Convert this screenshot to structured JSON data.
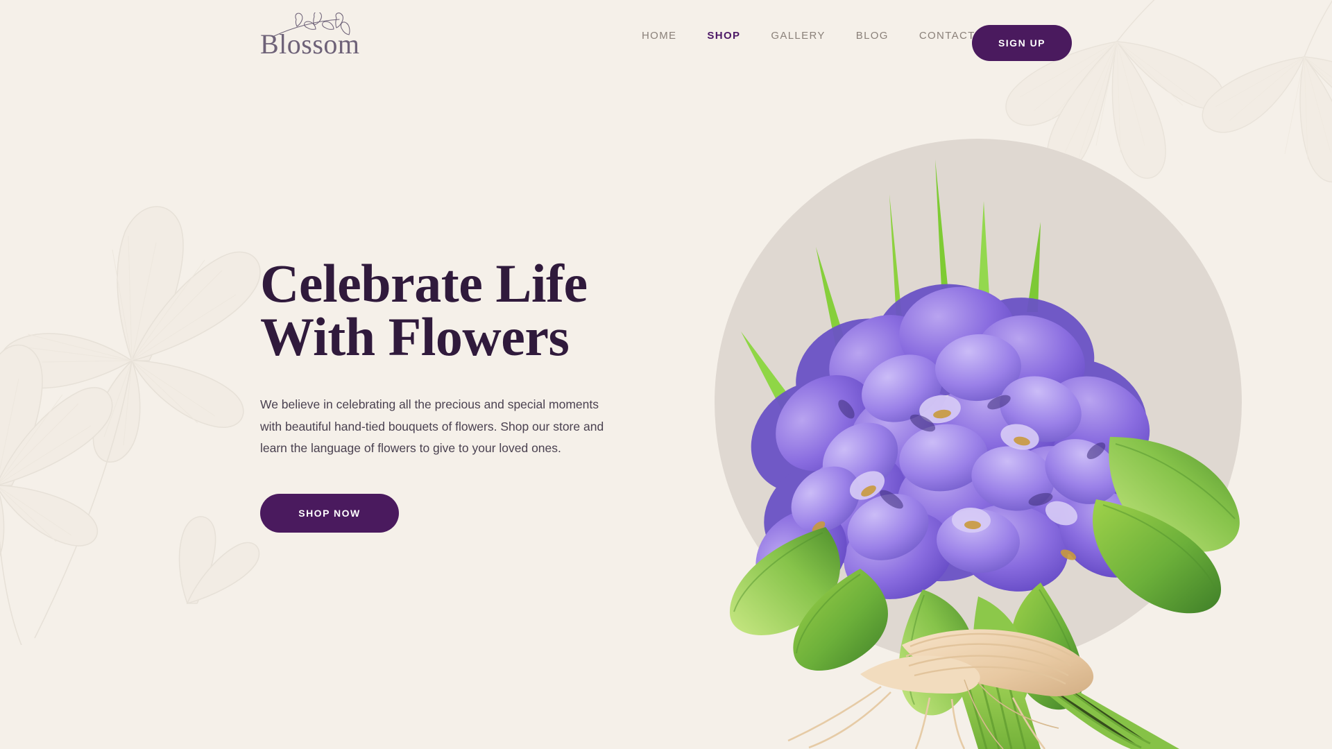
{
  "brand": {
    "name": "Blossom",
    "sprig_icon": "leaf-sprig-icon"
  },
  "nav": {
    "items": [
      {
        "label": "HOME",
        "active": false
      },
      {
        "label": "SHOP",
        "active": true
      },
      {
        "label": "GALLERY",
        "active": false
      },
      {
        "label": "BLOG",
        "active": false
      },
      {
        "label": "CONTACT",
        "active": false
      }
    ],
    "signup_label": "SIGN UP"
  },
  "hero": {
    "title_line1": "Celebrate Life",
    "title_line2": "With Flowers",
    "description": "We believe in celebrating all the precious and special moments with beautiful hand-tied bouquets of flowers. Shop our store and learn the language of flowers to give to your loved ones.",
    "cta_label": "SHOP NOW",
    "image_alt": "purple iris bouquet tied with raffia"
  },
  "colors": {
    "background": "#F5F0E9",
    "accent_purple": "#4A1A5E",
    "heading": "#301A3C",
    "body_text": "#4A4150",
    "nav_text": "#8A8079",
    "nav_active": "#4C1866",
    "logo_text": "#6E6278",
    "circle": "#DFD8D1",
    "decor_line": "#E7E1D8"
  }
}
